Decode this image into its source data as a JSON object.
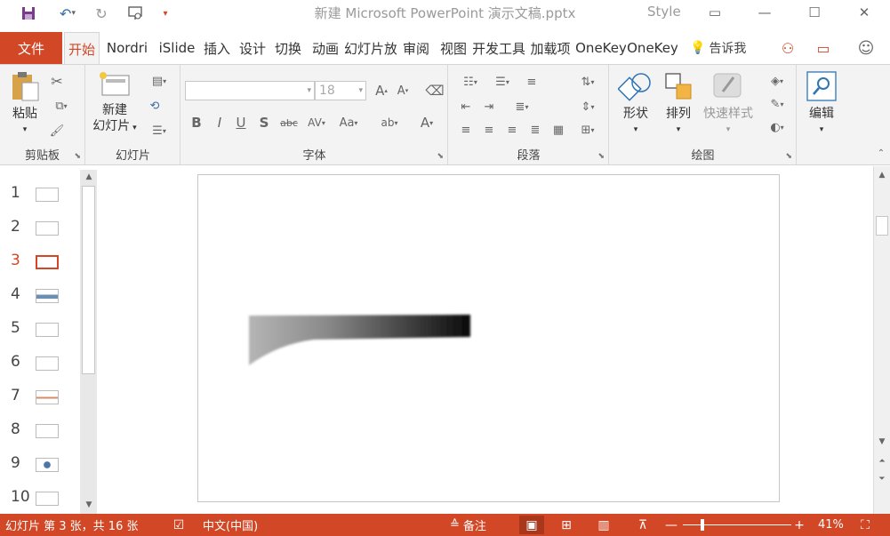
{
  "window": {
    "title": "新建 Microsoft PowerPoint 演示文稿.pptx",
    "style_label": "Style",
    "accent": "#d24726"
  },
  "quick_access": {
    "save_icon": "save-icon",
    "undo_icon": "undo-icon",
    "redo_icon": "redo-icon",
    "present_icon": "present-icon"
  },
  "tabs": {
    "file": "文件",
    "items": [
      "开始",
      "Nordri",
      "iSlide",
      "插入",
      "设计",
      "切换",
      "动画",
      "幻灯片放",
      "审阅",
      "视图",
      "开发工具",
      "加载项",
      "OneKey",
      "OneKey"
    ],
    "active_index": 0,
    "tell_me": "告诉我"
  },
  "ribbon": {
    "clipboard": {
      "label": "剪贴板",
      "paste": "粘贴"
    },
    "slides": {
      "label": "幻灯片",
      "new_slide_1": "新建",
      "new_slide_2": "幻灯片"
    },
    "font": {
      "label": "字体",
      "font_name": "",
      "font_size": "18"
    },
    "paragraph": {
      "label": "段落"
    },
    "drawing": {
      "label": "绘图",
      "shapes": "形状",
      "arrange": "排列",
      "quick_styles": "快速样式"
    },
    "editing": {
      "label": "编辑"
    }
  },
  "thumbnails": [
    "1",
    "2",
    "3",
    "4",
    "5",
    "6",
    "7",
    "8",
    "9",
    "10"
  ],
  "current_slide_index": 2,
  "status": {
    "slide_info": "幻灯片 第 3 张，共 16 张",
    "language": "中文(中国)",
    "notes": "备注",
    "zoom_percent": "41%",
    "zoom_level": 0.41
  }
}
